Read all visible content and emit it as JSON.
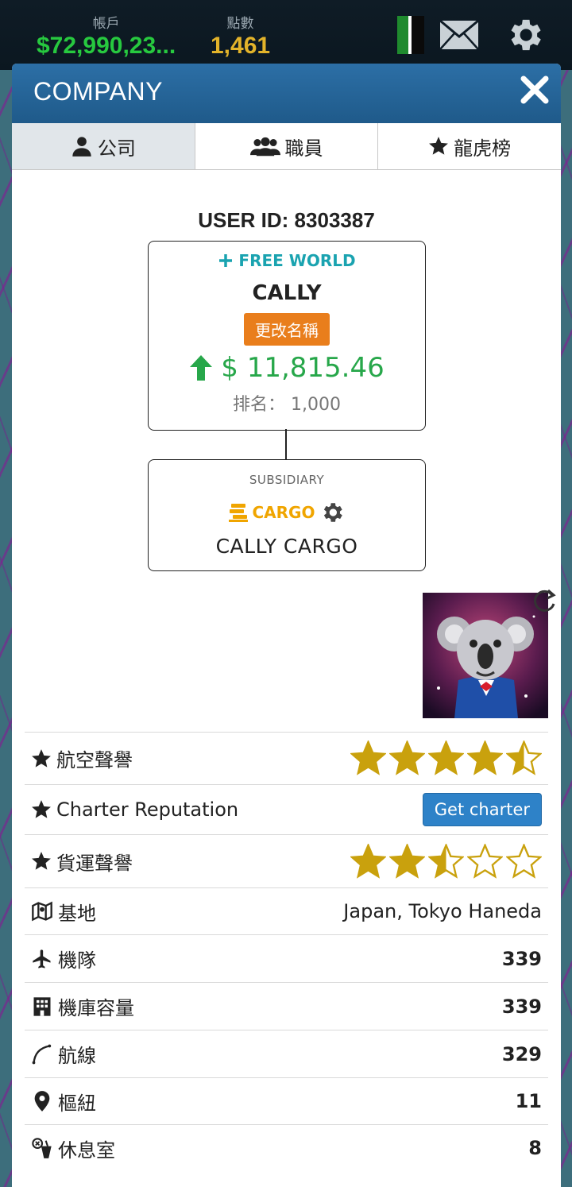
{
  "topbar": {
    "account_label": "帳戶",
    "account_value": "$72,990,23...",
    "points_label": "點數",
    "points_value": "1,461",
    "flag_colors": [
      "#1f8a2e",
      "#0a0a0a"
    ],
    "mail_icon": "mail-icon",
    "settings_icon": "gear-icon"
  },
  "modal": {
    "title": "COMPANY",
    "tabs": [
      {
        "label": "公司",
        "icon": "person-icon",
        "active": true
      },
      {
        "label": "職員",
        "icon": "group-icon",
        "active": false
      },
      {
        "label": "龍虎榜",
        "icon": "star-icon",
        "active": false
      }
    ]
  },
  "company": {
    "user_id": "USER ID: 8303387",
    "alliance": "FREE WORLD",
    "name": "CALLY",
    "rename_button": "更改名稱",
    "value": "$ 11,815.46",
    "rank_label": "排名：",
    "rank_value": "1,000"
  },
  "subsidiary": {
    "label": "SUBSIDIARY",
    "type": "CARGO",
    "name": "CALLY CARGO"
  },
  "stats": [
    {
      "label": "航空聲譽",
      "icon": "star-icon",
      "stars": 4.5
    },
    {
      "label": "Charter Reputation",
      "icon": "star-icon",
      "button": "Get charter"
    },
    {
      "label": "貨運聲譽",
      "icon": "star-icon",
      "stars": 2.5
    },
    {
      "label": "基地",
      "icon": "map-icon",
      "value": "Japan, Tokyo Haneda"
    },
    {
      "label": "機隊",
      "icon": "plane-icon",
      "value": "339"
    },
    {
      "label": "機庫容量",
      "icon": "building-icon",
      "value": "339"
    },
    {
      "label": "航線",
      "icon": "route-icon",
      "value": "329"
    },
    {
      "label": "樞紐",
      "icon": "pin-icon",
      "value": "11"
    },
    {
      "label": "休息室",
      "icon": "lounge-icon",
      "value": "8"
    }
  ],
  "colors": {
    "star_gold": "#c9a10d",
    "green": "#27a74a",
    "orange": "#e97e1c",
    "blue": "#2e82c8",
    "header_blue": "#2365a0"
  }
}
